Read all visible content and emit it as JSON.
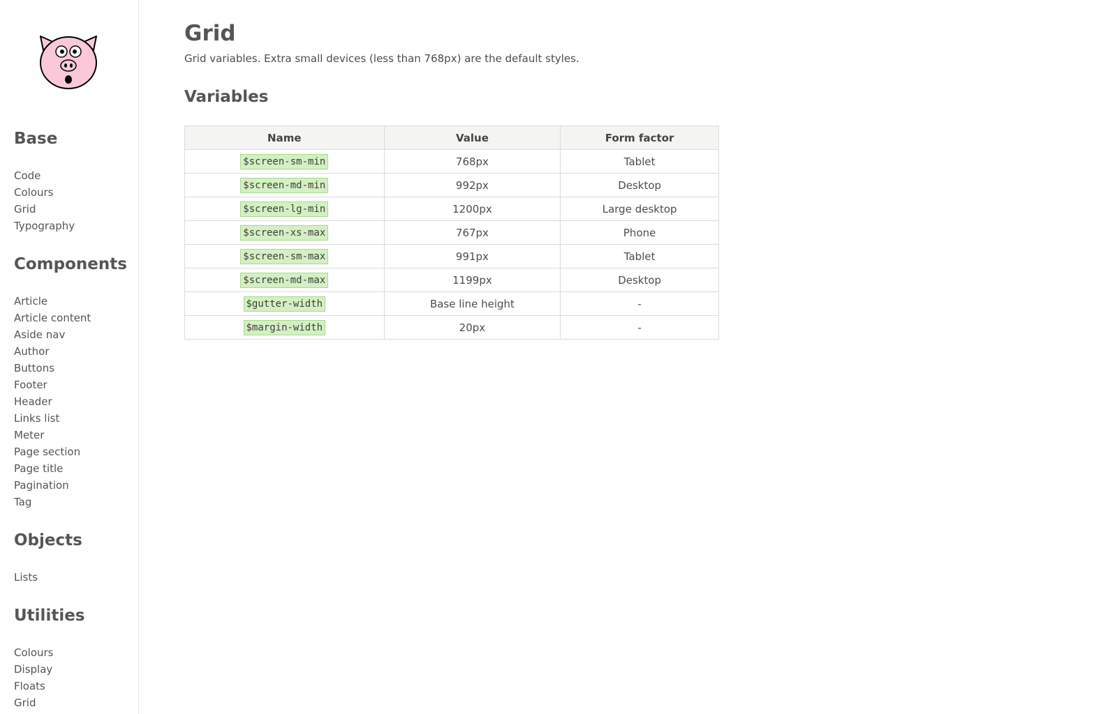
{
  "sidebar": {
    "sections": [
      {
        "heading": "Base",
        "items": [
          "Code",
          "Colours",
          "Grid",
          "Typography"
        ]
      },
      {
        "heading": "Components",
        "items": [
          "Article",
          "Article content",
          "Aside nav",
          "Author",
          "Buttons",
          "Footer",
          "Header",
          "Links list",
          "Meter",
          "Page section",
          "Page title",
          "Pagination",
          "Tag"
        ]
      },
      {
        "heading": "Objects",
        "items": [
          "Lists"
        ]
      },
      {
        "heading": "Utilities",
        "items": [
          "Colours",
          "Display",
          "Floats",
          "Grid"
        ]
      }
    ]
  },
  "main": {
    "title": "Grid",
    "description": "Grid variables. Extra small devices (less than 768px) are the default styles.",
    "section_title": "Variables",
    "table": {
      "headers": [
        "Name",
        "Value",
        "Form factor"
      ],
      "rows": [
        [
          "$screen-sm-min",
          "768px",
          "Tablet"
        ],
        [
          "$screen-md-min",
          "992px",
          "Desktop"
        ],
        [
          "$screen-lg-min",
          "1200px",
          "Large desktop"
        ],
        [
          "$screen-xs-max",
          "767px",
          "Phone"
        ],
        [
          "$screen-sm-max",
          "991px",
          "Tablet"
        ],
        [
          "$screen-md-max",
          "1199px",
          "Desktop"
        ],
        [
          "$gutter-width",
          "Base line height",
          "-"
        ],
        [
          "$margin-width",
          "20px",
          "-"
        ]
      ]
    }
  },
  "colors": {
    "text": "#4d4d4d",
    "heading": "#555555",
    "code_bg": "#d4f0c2",
    "code_border": "#a9d88e",
    "table_header_bg": "#f4f4f2",
    "pig_pink": "#fbc8d9"
  },
  "icons": {
    "logo": "pig-face-icon"
  }
}
